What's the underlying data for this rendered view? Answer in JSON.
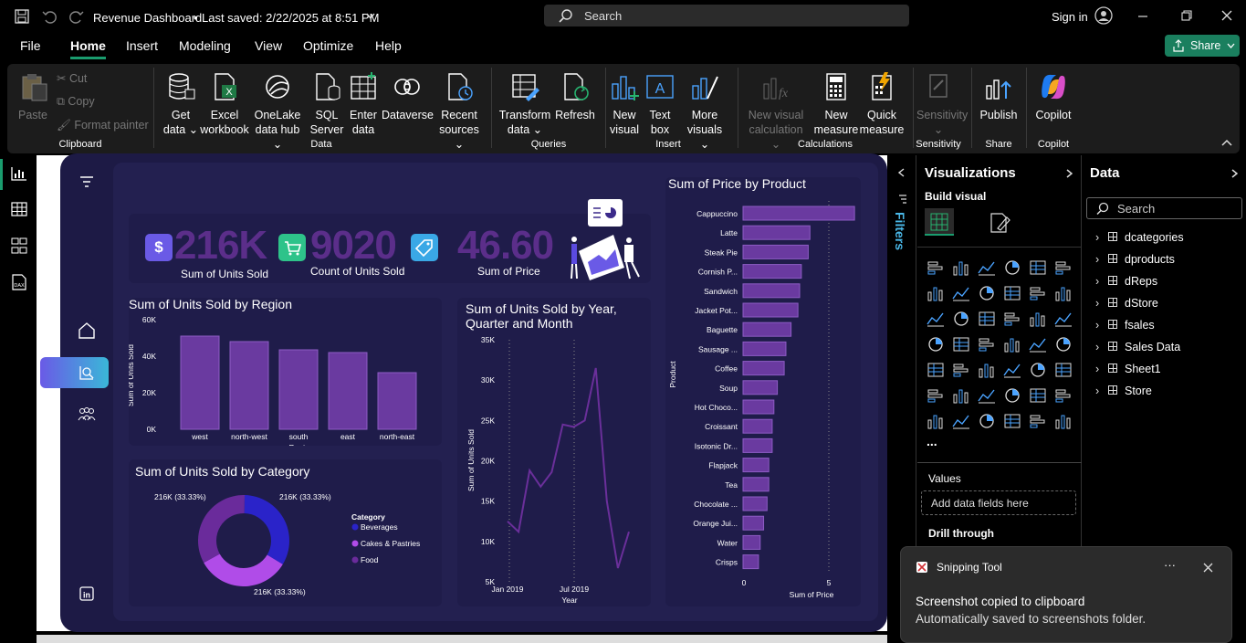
{
  "titlebar": {
    "doc_title": "Revenue Dashboard",
    "saved": "Last saved: 2/22/2025 at 8:51 PM",
    "search_placeholder": "Search",
    "sign_in": "Sign in"
  },
  "menu": {
    "file": "File",
    "home": "Home",
    "insert": "Insert",
    "modeling": "Modeling",
    "view": "View",
    "optimize": "Optimize",
    "help": "Help",
    "share": "Share"
  },
  "ribbon": {
    "paste": "Paste",
    "cut": "Cut",
    "copy": "Copy",
    "format_painter": "Format painter",
    "clipboard": "Clipboard",
    "get_data_1": "Get",
    "get_data_2": "data",
    "excel_1": "Excel",
    "excel_2": "workbook",
    "onelake_1": "OneLake",
    "onelake_2": "data hub",
    "sql_1": "SQL",
    "sql_2": "Server",
    "enter_1": "Enter",
    "enter_2": "data",
    "dataverse": "Dataverse",
    "recent_1": "Recent",
    "recent_2": "sources",
    "data_group": "Data",
    "transform_1": "Transform",
    "transform_2": "data",
    "refresh": "Refresh",
    "queries": "Queries",
    "new_visual_1": "New",
    "new_visual_2": "visual",
    "text_box_1": "Text",
    "text_box_2": "box",
    "more_visuals_1": "More",
    "more_visuals_2": "visuals",
    "insert_group": "Insert",
    "new_visual_calc_1": "New visual",
    "new_visual_calc_2": "calculation",
    "new_measure_1": "New",
    "new_measure_2": "measure",
    "quick_measure_1": "Quick",
    "quick_measure_2": "measure",
    "calculations": "Calculations",
    "sensitivity": "Sensitivity",
    "sensitivity_group": "Sensitivity",
    "publish": "Publish",
    "share_group": "Share",
    "copilot": "Copilot",
    "copilot_group": "Copilot"
  },
  "kpis": [
    {
      "value": "216K",
      "label": "Sum of Units Sold"
    },
    {
      "value": "9020",
      "label": "Count of Units Sold"
    },
    {
      "value": "46.60",
      "label": "Sum of Price"
    }
  ],
  "chart_data": [
    {
      "type": "bar",
      "title": "Sum of Units Sold by Region",
      "xlabel": "Region",
      "ylabel": "Sum of Units Sold",
      "categories": [
        "west",
        "north-west",
        "south",
        "east",
        "north-east"
      ],
      "values": [
        51000,
        48000,
        43500,
        42000,
        31000
      ],
      "yticks": [
        "0K",
        "20K",
        "40K",
        "60K"
      ],
      "ylim": [
        0,
        60000
      ]
    },
    {
      "type": "line",
      "title": "Sum of Units Sold by Year, Quarter and Month",
      "xlabel": "Year",
      "ylabel": "Sum of Units Sold",
      "xticks": [
        "Jan 2019",
        "Jul 2019"
      ],
      "yticks": [
        "5K",
        "10K",
        "15K",
        "20K",
        "25K",
        "30K",
        "35K"
      ],
      "ylim": [
        5000,
        35000
      ],
      "values": [
        12500,
        11200,
        18800,
        16800,
        18600,
        24500,
        24200,
        25000,
        31500,
        15000,
        6700,
        11200
      ]
    },
    {
      "type": "bar",
      "title": "Sum of Price by Product",
      "xlabel": "Sum of Price",
      "ylabel": "Product",
      "xticks": [
        "0",
        "5"
      ],
      "xlim": [
        0,
        6.6
      ],
      "categories": [
        "Cappuccino",
        "Latte",
        "Steak Pie",
        "Cornish P...",
        "Sandwich",
        "Jacket Pot...",
        "Baguette",
        "Sausage ...",
        "Coffee",
        "Soup",
        "Hot Choco...",
        "Croissant",
        "Isotonic Dr...",
        "Flapjack",
        "Tea",
        "Chocolate ...",
        "Orange Jui...",
        "Water",
        "Crisps"
      ],
      "values": [
        6.5,
        3.9,
        3.8,
        3.4,
        3.3,
        3.2,
        2.8,
        2.5,
        2.4,
        2.0,
        1.8,
        1.7,
        1.7,
        1.5,
        1.5,
        1.4,
        1.2,
        1.0,
        0.9
      ]
    },
    {
      "type": "pie",
      "title": "Sum of Units Sold by Category",
      "legend_title": "Category",
      "categories": [
        "Beverages",
        "Cakes & Pastries",
        "Food"
      ],
      "labels": [
        "216K (33.33%)",
        "216K (33.33%)",
        "216K (33.33%)"
      ],
      "values": [
        33.33,
        33.33,
        33.33
      ],
      "colors": [
        "#2a23c9",
        "#b04ce8",
        "#6a2b9b"
      ]
    }
  ],
  "filters": {
    "label": "Filters"
  },
  "visualizations": {
    "title": "Visualizations",
    "build_visual": "Build visual",
    "more": "...",
    "values": "Values",
    "add_fields": "Add data fields here",
    "drill_through": "Drill through"
  },
  "data_pane": {
    "title": "Data",
    "search_placeholder": "Search",
    "tables": [
      "dcategories",
      "dproducts",
      "dReps",
      "dStore",
      "fsales",
      "Sales Data",
      "Sheet1",
      "Store"
    ]
  },
  "toast": {
    "app": "Snipping Tool",
    "title": "Screenshot copied to clipboard",
    "body": "Automatically saved to screenshots folder."
  },
  "colors": {
    "accent": "#6a3aa0",
    "dash_bg": "#1d1a45",
    "green": "#1a7f5e"
  }
}
